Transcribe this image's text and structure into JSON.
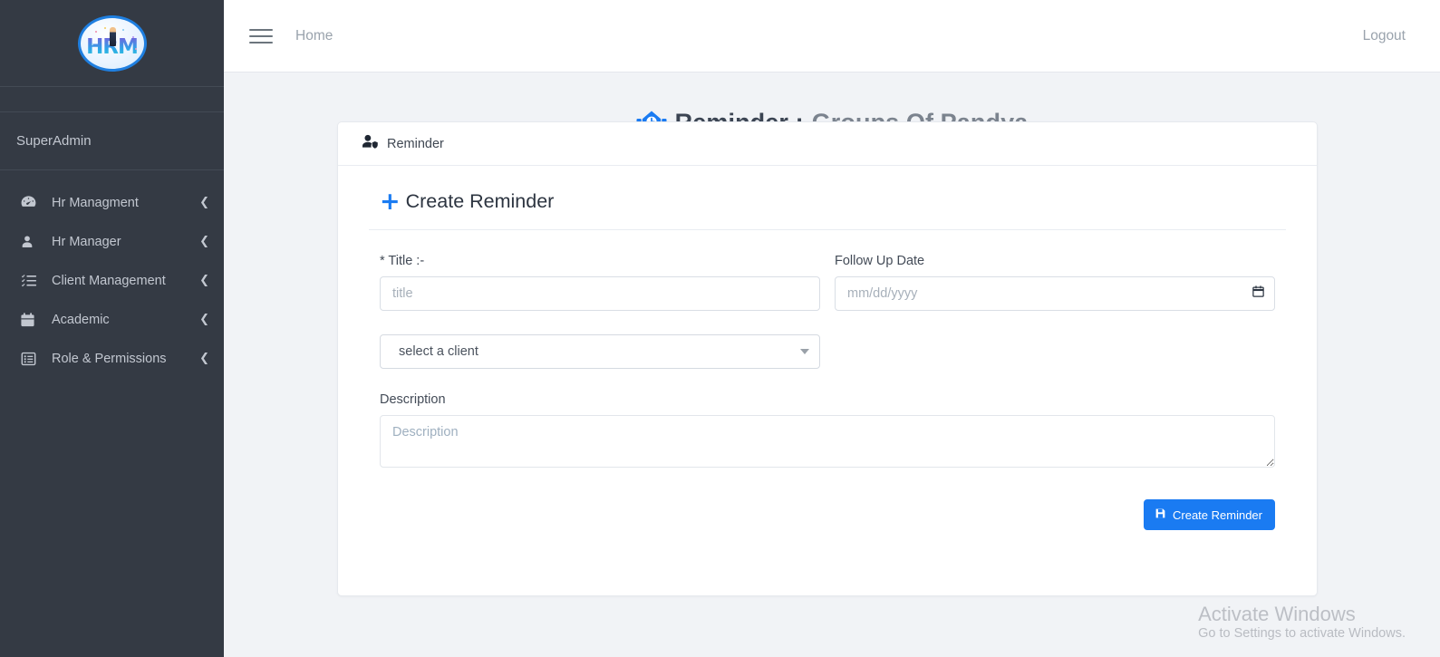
{
  "sidebar": {
    "logo_text": "HRM",
    "user_role": "SuperAdmin",
    "items": [
      {
        "label": "Hr Managment",
        "icon": "dashboard-icon",
        "caret": "❮"
      },
      {
        "label": "Hr Manager",
        "icon": "user-icon",
        "caret": "❮"
      },
      {
        "label": "Client Management",
        "icon": "tasks-list-icon",
        "caret": "❮"
      },
      {
        "label": "Academic",
        "icon": "calendar-icon",
        "caret": "❮"
      },
      {
        "label": "Role & Permissions",
        "icon": "list-alt-icon",
        "caret": "❮"
      }
    ]
  },
  "topbar": {
    "menu_icon": "hamburger-icon",
    "breadcrumb": "Home",
    "logout_label": "Logout"
  },
  "page": {
    "title_icon": "reminder-building-clock-icon",
    "title": "Reminder :",
    "subtitle": "Groups Of Pandya"
  },
  "card": {
    "header_icon": "user-shield-icon",
    "header_label": "Reminder",
    "section_plus_icon": "plus-icon",
    "section_title": "Create Reminder",
    "fields": {
      "title_label": "* Title :-",
      "title_placeholder": "title",
      "title_value": "",
      "followup_label": "Follow Up Date",
      "followup_placeholder": "mm/dd/yyyy",
      "followup_value": "",
      "followup_icon": "calendar-picker-icon",
      "client_selected": "select a client",
      "client_caret_icon": "chevron-down-icon",
      "description_label": "Description",
      "description_placeholder": "Description",
      "description_value": ""
    },
    "submit": {
      "icon": "save-icon",
      "label": "Create Reminder"
    }
  },
  "watermark": {
    "line1": "Activate Windows",
    "line2": "Go to Settings to activate Windows."
  },
  "colors": {
    "sidebar_bg": "#343a44",
    "accent": "#1a7bf2",
    "content_bg": "#f1f3f6",
    "muted_text": "#7b838e"
  }
}
